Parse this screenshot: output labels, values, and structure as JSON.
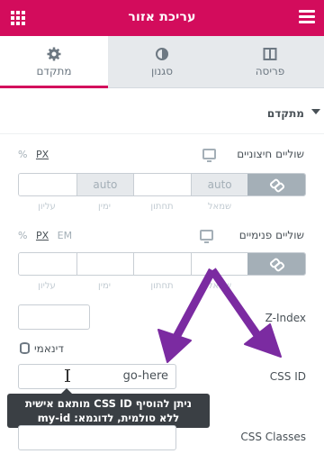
{
  "header": {
    "title": "עריכת אזור",
    "menu_icon": "hamburger-icon",
    "grid_icon": "apps-grid-icon"
  },
  "tabs": [
    {
      "label": "פריסה",
      "icon": "layout-icon"
    },
    {
      "label": "סגנון",
      "icon": "half-circle-icon"
    },
    {
      "label": "מתקדם",
      "icon": "gear-icon",
      "active": true
    }
  ],
  "section": {
    "title": "מתקדם"
  },
  "margin": {
    "label": "שוליים חיצוניים",
    "units": [
      "PX",
      "%"
    ],
    "active_unit": "PX",
    "values": [
      "",
      "",
      "auto",
      "",
      "auto"
    ],
    "sublabels": [
      "עליון",
      "ימין",
      "תחתון",
      "שמאל"
    ]
  },
  "padding": {
    "label": "שוליים פנימיים",
    "units": [
      "EM",
      "PX",
      "%"
    ],
    "active_unit": "PX",
    "sublabels": [
      "עליון",
      "ימין",
      "תחתון",
      "שמאל"
    ]
  },
  "zindex": {
    "label": "Z-Index",
    "value": ""
  },
  "dynamic": {
    "label": "דינאמי"
  },
  "cssid": {
    "label": "CSS ID",
    "value": "go-here"
  },
  "tooltip": {
    "line1": "ניתן להוסיף CSS ID מותאם אישית",
    "line2": "ללא סולמית, לדוגמא: my-id"
  },
  "cssclasses": {
    "label": "CSS Classes",
    "value": ""
  },
  "colors": {
    "brand": "#d30c5c",
    "annotation_arrow": "#7b2ba1"
  }
}
